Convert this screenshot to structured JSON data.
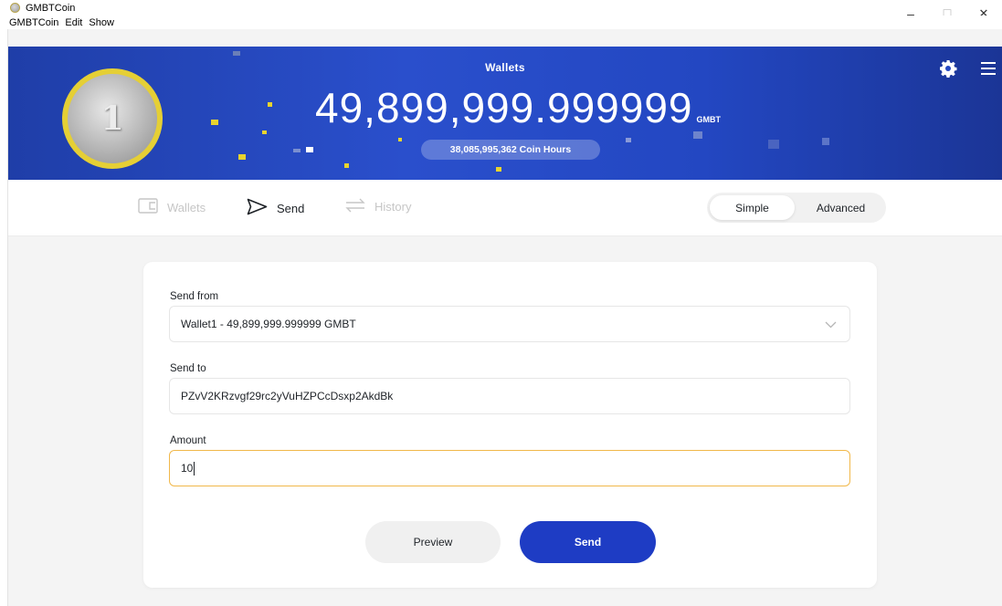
{
  "window": {
    "title": "GMBTCoin",
    "controls": {
      "minimize": "–",
      "maximize": "☐",
      "close": "✕"
    }
  },
  "menu": {
    "items": [
      "GMBTCoin",
      "Edit",
      "Show"
    ]
  },
  "header": {
    "title": "Wallets",
    "balance": "49,899,999.999999",
    "unit": "GMBT",
    "coin_hours": "38,085,995,362 Coin Hours",
    "coin_symbol": "1",
    "accent": "#2a4fcc",
    "coin_rim": "#e5cf35"
  },
  "nav": {
    "wallets": "Wallets",
    "send": "Send",
    "history": "History",
    "mode_simple": "Simple",
    "mode_advanced": "Advanced",
    "selected_mode": "Simple"
  },
  "form": {
    "send_from_label": "Send from",
    "send_from_value": "Wallet1 - 49,899,999.999999 GMBT",
    "send_to_label": "Send to",
    "send_to_value": "PZvV2KRzvgf29rc2yVuHZPCcDsxp2AkdBk",
    "amount_label": "Amount",
    "amount_value": "10",
    "focus_color": "#f1b84a"
  },
  "buttons": {
    "preview": "Preview",
    "send": "Send",
    "send_color": "#1e3cc4"
  },
  "icons": {
    "settings": "gear-icon",
    "menu": "hamburger-icon",
    "wallets": "wallet-icon",
    "send": "send-icon",
    "history": "history-icon",
    "dropdown": "chevron-down-icon"
  }
}
